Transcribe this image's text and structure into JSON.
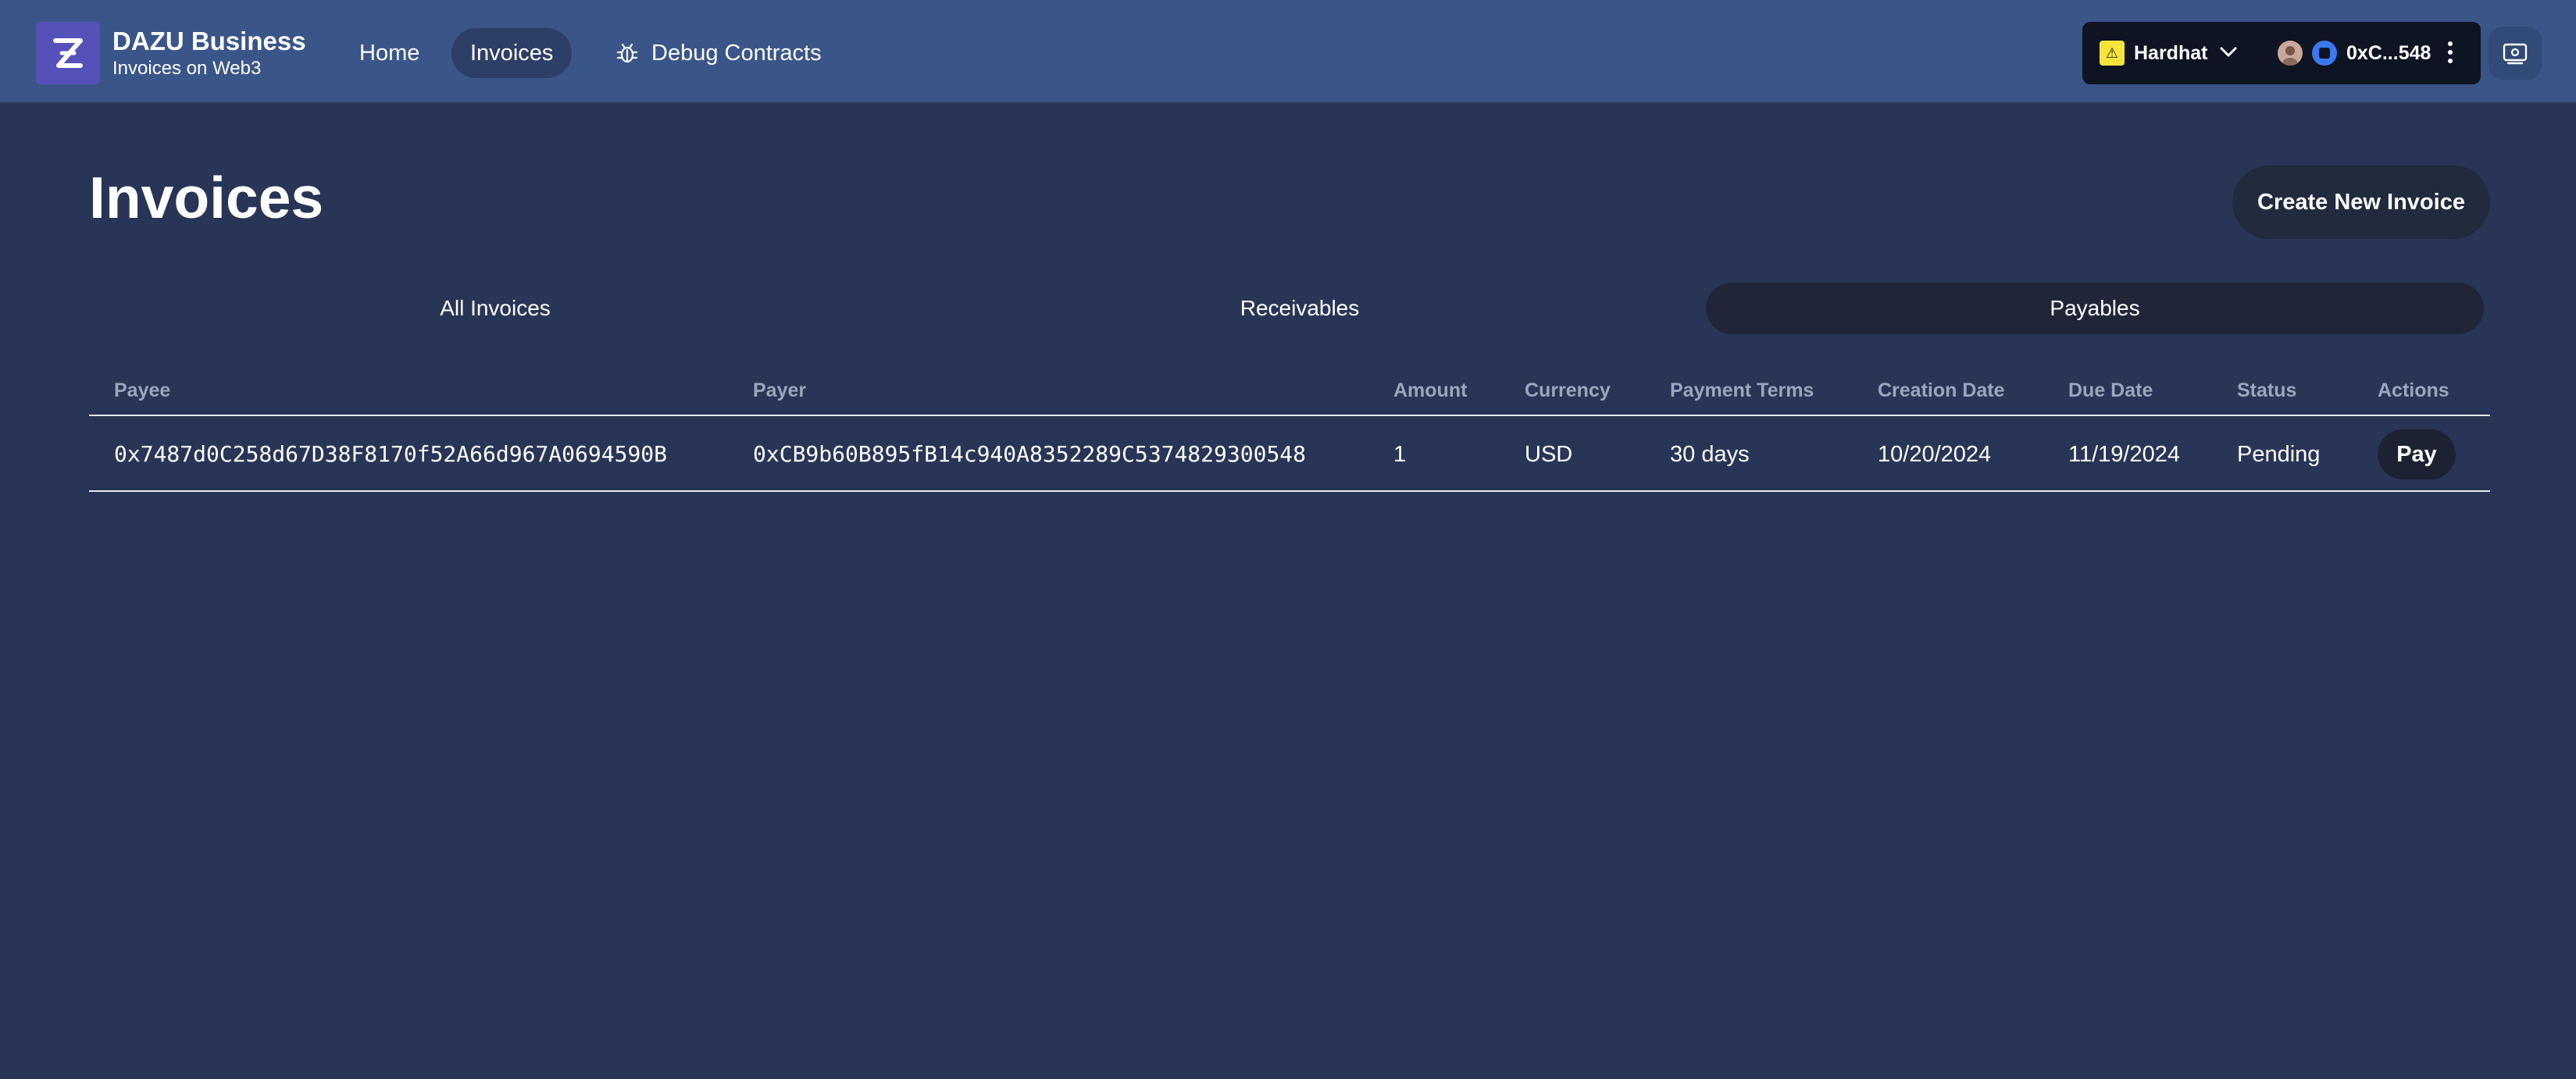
{
  "app": {
    "brand_title": "DAZU Business",
    "brand_subtitle": "Invoices on Web3",
    "logo_icon": "z-logo-icon"
  },
  "nav": {
    "home": "Home",
    "invoices": "Invoices",
    "debug": "Debug Contracts",
    "debug_icon": "bug-icon"
  },
  "wallet": {
    "network": "Hardhat",
    "address": "0xC...548"
  },
  "page": {
    "title": "Invoices",
    "create_button": "Create New Invoice"
  },
  "tabs": [
    {
      "label": "All Invoices",
      "active": false
    },
    {
      "label": "Receivables",
      "active": false
    },
    {
      "label": "Payables",
      "active": true
    }
  ],
  "table": {
    "headers": [
      "Payee",
      "Payer",
      "Amount",
      "Currency",
      "Payment Terms",
      "Creation Date",
      "Due Date",
      "Status",
      "Actions"
    ],
    "rows": [
      {
        "payee": "0x7487d0C258d67D38F8170f52A66d967A0694590B",
        "payer": "0xCB9b60B895fB14c940A8352289C5374829300548",
        "amount": "1",
        "currency": "USD",
        "payment_terms": "30 days",
        "creation_date": "10/20/2024",
        "due_date": "11/19/2024",
        "status": "Pending",
        "action": "Pay"
      }
    ]
  },
  "colors": {
    "navbar": "#3a5588",
    "background": "#293556",
    "network_badge": "#f6e43a"
  }
}
